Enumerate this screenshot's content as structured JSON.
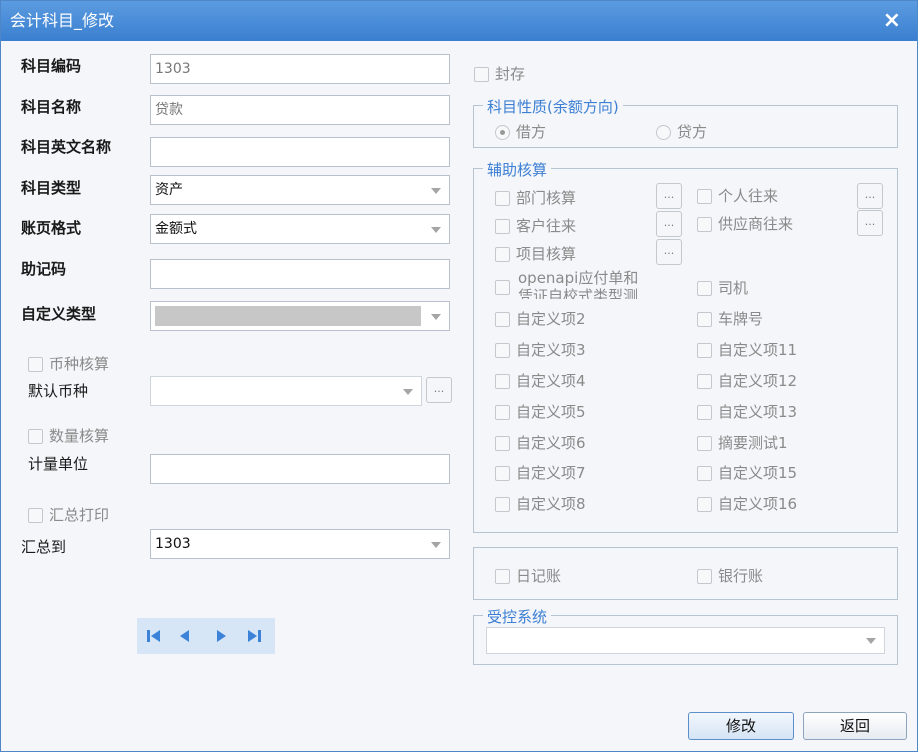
{
  "window": {
    "title": "会计科目_修改",
    "close": "×"
  },
  "left": {
    "code_label": "科目编码",
    "code_value": "1303",
    "name_label": "科目名称",
    "name_value": "贷款",
    "en_name_label": "科目英文名称",
    "en_name_value": "",
    "type_label": "科目类型",
    "type_value": "资产",
    "format_label": "账页格式",
    "format_value": "金额式",
    "mnemonic_label": "助记码",
    "mnemonic_value": "",
    "custom_type_label": "自定义类型",
    "currency_check_label": "币种核算",
    "default_currency_label": "默认币种",
    "quantity_check_label": "数量核算",
    "unit_label": "计量单位",
    "summary_print_label": "汇总打印",
    "summary_to_label": "汇总到",
    "summary_to_value": "1303"
  },
  "right": {
    "archive_label": "封存",
    "nature_legend": "科目性质(余额方向)",
    "debit_label": "借方",
    "credit_label": "贷方",
    "aux_legend": "辅助核算",
    "aux_left": [
      "部门核算",
      "客户往来",
      "项目核算",
      "openapi应付单和\n凭证自校式类型测",
      "自定义项2",
      "自定义项3",
      "自定义项4",
      "自定义项5",
      "自定义项6",
      "自定义项7",
      "自定义项8"
    ],
    "aux_right": [
      "个人往来",
      "供应商往来",
      "司机",
      "车牌号",
      "自定义项11",
      "自定义项12",
      "自定义项13",
      "摘要测试1",
      "自定义项15",
      "自定义项16"
    ],
    "journal_label": "日记账",
    "bank_journal_label": "银行账",
    "controlled_legend": "受控系统"
  },
  "buttons": {
    "dots": "...",
    "modify": "修改",
    "back": "返回"
  },
  "colors": {
    "titlebar": "#3a7fd0",
    "legend": "#3c7fd3",
    "nav_icon": "#3c82d8"
  }
}
